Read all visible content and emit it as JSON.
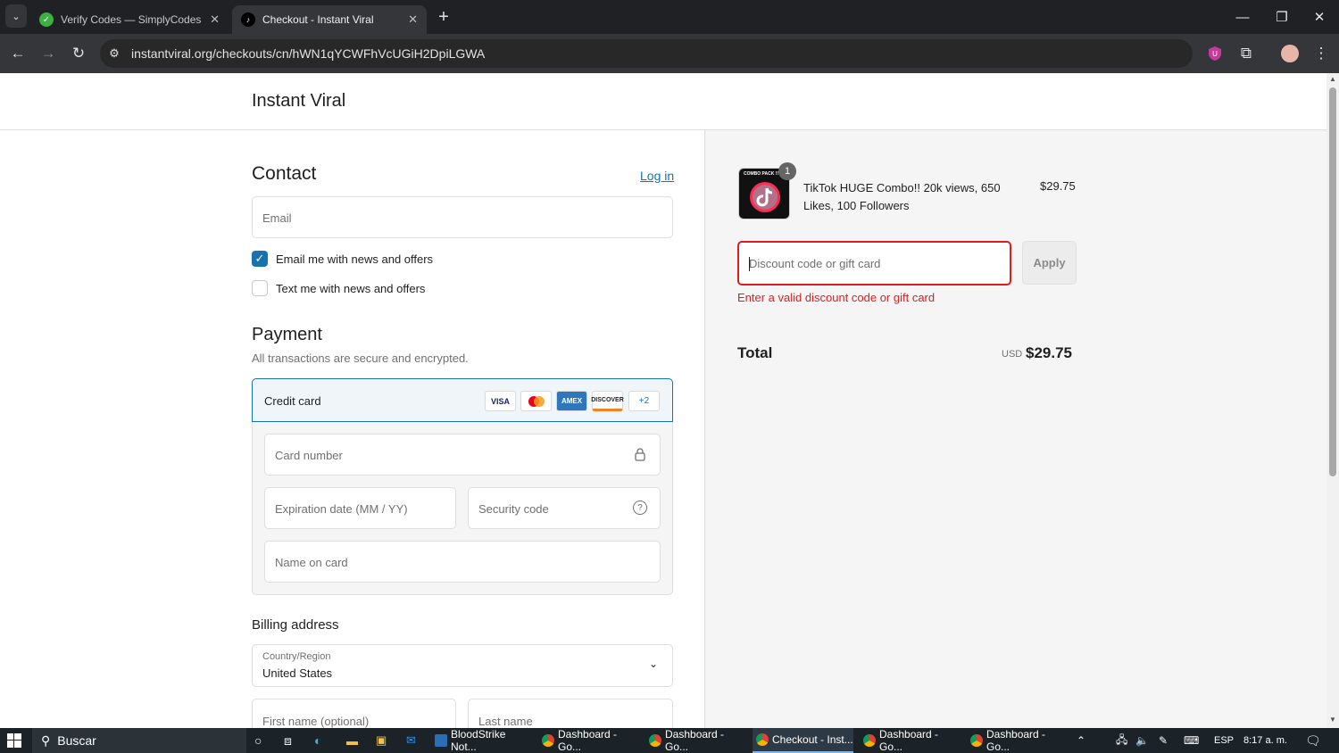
{
  "browser": {
    "tabs": [
      {
        "title": "Verify Codes — SimplyCodes",
        "active": false
      },
      {
        "title": "Checkout - Instant Viral",
        "active": true
      }
    ],
    "url": "instantviral.org/checkouts/cn/hWN1qYCWFhVcUGiH2DpiLGWA"
  },
  "store": {
    "name": "Instant Viral"
  },
  "contact": {
    "title": "Contact",
    "login_link": "Log in",
    "email_placeholder": "Email",
    "news_email_label": "Email me with news and offers",
    "news_email_checked": true,
    "news_text_label": "Text me with news and offers",
    "news_text_checked": false
  },
  "payment": {
    "title": "Payment",
    "subtitle": "All transactions are secure and encrypted.",
    "method_label": "Credit card",
    "card_brands": [
      "VISA",
      "AMEX",
      "DISCOVER"
    ],
    "more_brands": "+2",
    "card_number_placeholder": "Card number",
    "expiry_placeholder": "Expiration date (MM / YY)",
    "security_placeholder": "Security code",
    "name_placeholder": "Name on card"
  },
  "billing": {
    "title": "Billing address",
    "country_label": "Country/Region",
    "country_value": "United States",
    "first_name_placeholder": "First name (optional)",
    "last_name_placeholder": "Last name"
  },
  "summary": {
    "item_title": "TikTok HUGE Combo!! 20k views, 650 Likes, 100 Followers",
    "item_thumb_text": "COMBO PACK !!",
    "item_quantity": "1",
    "item_price": "$29.75",
    "discount_placeholder": "Discount code or gift card",
    "apply_label": "Apply",
    "discount_error": "Enter a valid discount code or gift card",
    "total_label": "Total",
    "total_currency": "USD",
    "total_value": "$29.75"
  },
  "taskbar": {
    "search_label": "Buscar",
    "apps": [
      {
        "label": "BloodStrike Not..."
      },
      {
        "label": "Dashboard - Go..."
      },
      {
        "label": "Dashboard - Go..."
      },
      {
        "label": "Checkout - Inst..."
      },
      {
        "label": "Dashboard - Go..."
      },
      {
        "label": "Dashboard - Go..."
      }
    ],
    "language": "ESP",
    "time": "8:17 a. m."
  },
  "colors": {
    "accent": "#1773b0",
    "error": "#dd1d1d",
    "checkbox": "#1773b0"
  }
}
